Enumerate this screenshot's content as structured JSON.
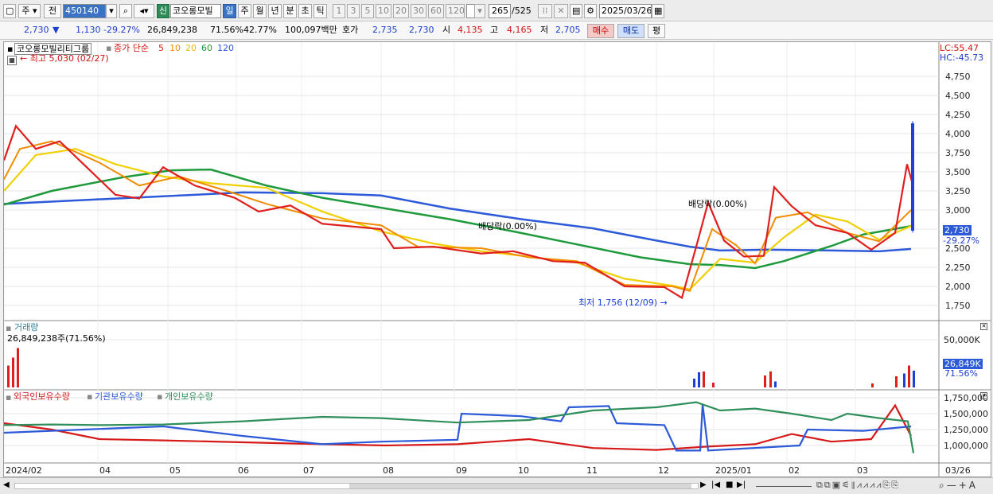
{
  "toolbar": {
    "market_sel": "주",
    "prev_btn": "전",
    "code": "450140",
    "badge_new": "신",
    "stock_name": "코오롱모빌",
    "periods": [
      "일",
      "주",
      "월",
      "년",
      "분",
      "초",
      "틱"
    ],
    "intervals": [
      "1",
      "3",
      "5",
      "10",
      "20",
      "30",
      "60",
      "120"
    ],
    "count": "265",
    "total": "/525",
    "date": "2025/03/26"
  },
  "quote": {
    "price": "2,730",
    "arrow": "▼",
    "change": "1,130",
    "change_pct": "-29.27%",
    "volume": "26,849,238",
    "turnover_pct": "71.56%",
    "pct2": "42.77%",
    "amount": "100,097백만",
    "bid_label": "호가",
    "bid1": "2,735",
    "bid2": "2,730",
    "open_label": "시",
    "open": "4,135",
    "high_label": "고",
    "high": "4,165",
    "low_label": "저",
    "low": "2,705",
    "buy_btn": "매수",
    "sell_btn": "매도",
    "eval_btn": "평"
  },
  "price_panel": {
    "title": "코오롱모빌리티그룹",
    "indicator": "종가 단순",
    "ma": [
      "5",
      "10",
      "20",
      "60",
      "120"
    ],
    "ma_colors": [
      "#e01e1e",
      "#f08c00",
      "#f0d000",
      "#1e9a3c",
      "#2c5ad8"
    ],
    "lc": "LC:55.47",
    "hc": "HC:-45.73",
    "high_note": "최고 5,030 (02/27)",
    "low_note": "최저 1,756 (12/09)",
    "div_note_1": "배당락(0.00%)",
    "div_note_2": "배당락(0.00%)",
    "cur_price": "2,730",
    "cur_pct": "-29.27%",
    "y_ticks": [
      "4,750",
      "4,500",
      "4,250",
      "4,000",
      "3,750",
      "3,500",
      "3,250",
      "3,000",
      "2,750",
      "2,500",
      "2,250",
      "2,000",
      "1,750"
    ]
  },
  "volume_panel": {
    "title": "거래량",
    "value": "26,849,238주(71.56%)",
    "y_tick": "50,000K",
    "cur_vol": "26,849K",
    "cur_pct": "71.56%"
  },
  "holding_panel": {
    "series": [
      "외국인보유수량",
      "기관보유수량",
      "개인보유수량"
    ],
    "series_colors": [
      "#d61a1a",
      "#2c5ad8",
      "#2f8f5b"
    ],
    "y_ticks": [
      "1,750,000",
      "1,500,000",
      "1,250,000",
      "1,000,000"
    ]
  },
  "x_axis": {
    "labels": [
      "2024/02",
      "04",
      "05",
      "06",
      "07",
      "08",
      "09",
      "10",
      "11",
      "12",
      "2025/01",
      "02",
      "03"
    ],
    "end_label": "03/26"
  },
  "colors": {
    "up": "#e01e1e",
    "down": "#1e3fd8",
    "accent": "#3a72c4"
  },
  "icons": [
    "chart-type-icon",
    "dropdown-icon",
    "back-icon",
    "lock-icon",
    "save-icon",
    "settings-icon",
    "calendar-icon",
    "scroll-left-icon",
    "scroll-right-icon",
    "play-icon",
    "stop-icon",
    "zoom-icon"
  ]
}
